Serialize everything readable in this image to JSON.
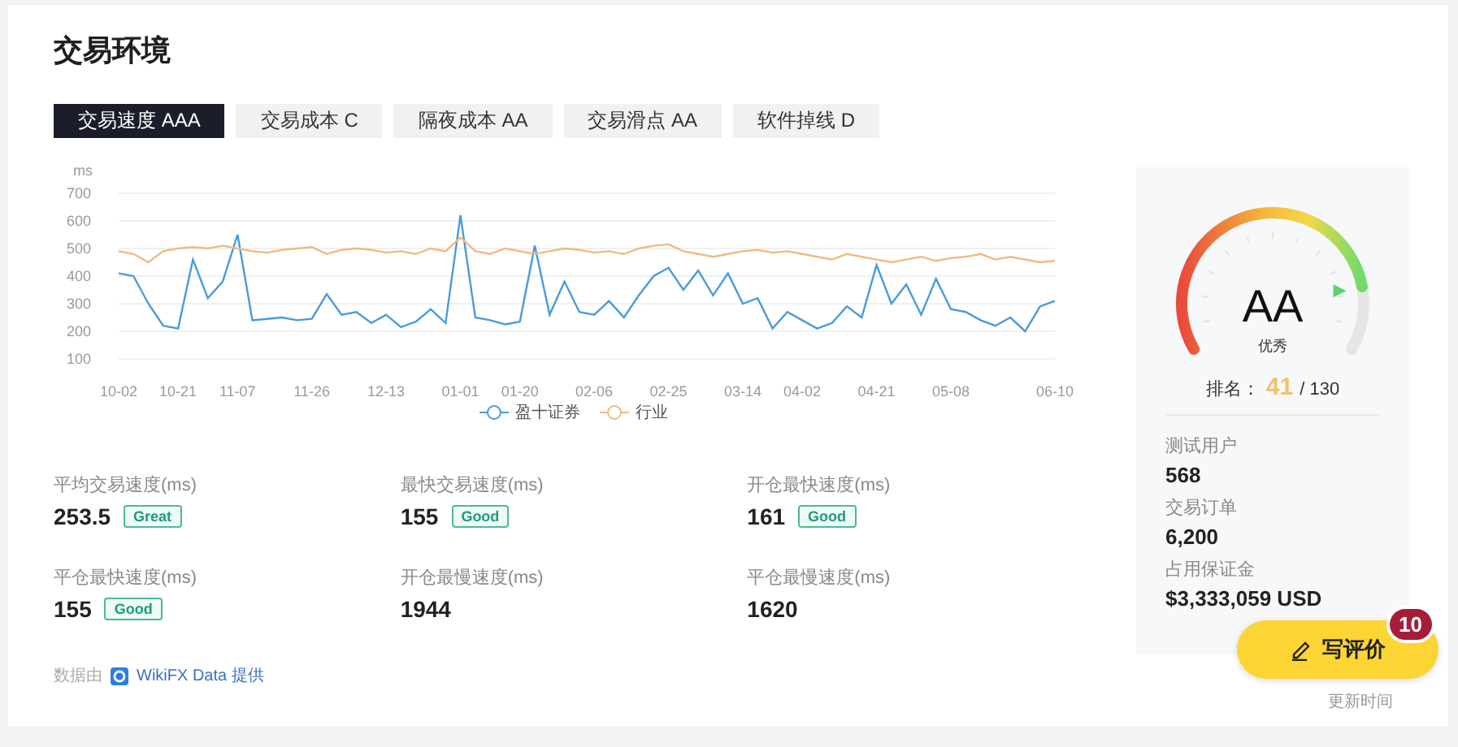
{
  "section": {
    "title": "交易环境"
  },
  "tabs": [
    {
      "label": "交易速度 AAA",
      "selected": true
    },
    {
      "label": "交易成本 C",
      "selected": false
    },
    {
      "label": "隔夜成本 AA",
      "selected": false
    },
    {
      "label": "交易滑点 AA",
      "selected": false
    },
    {
      "label": "软件掉线 D",
      "selected": false
    }
  ],
  "chart": {
    "chart_data": {
      "type": "line",
      "ylabel": "ms",
      "categories": [
        "10-02",
        null,
        null,
        null,
        "10-21",
        null,
        null,
        null,
        "11-07",
        null,
        null,
        null,
        null,
        "11-26",
        null,
        null,
        null,
        null,
        "12-13",
        null,
        null,
        null,
        null,
        "01-01",
        null,
        null,
        null,
        "01-20",
        null,
        null,
        null,
        null,
        "02-06",
        null,
        null,
        null,
        null,
        "02-25",
        null,
        null,
        null,
        null,
        "03-14",
        null,
        null,
        null,
        "04-02",
        null,
        null,
        null,
        null,
        "04-21",
        null,
        null,
        null,
        null,
        "05-08",
        null,
        null,
        null,
        null,
        null,
        null,
        "06-10"
      ],
      "grid": true,
      "ylim": [
        100,
        700
      ],
      "yticks": [
        100,
        200,
        300,
        400,
        500,
        600,
        700
      ],
      "series": [
        {
          "name": "盈十证券",
          "color": "#4a9bdc",
          "values": [
            410,
            400,
            300,
            220,
            210,
            460,
            320,
            380,
            550,
            240,
            245,
            250,
            240,
            245,
            335,
            260,
            270,
            230,
            260,
            215,
            235,
            280,
            230,
            620,
            250,
            240,
            225,
            235,
            510,
            260,
            380,
            270,
            260,
            310,
            250,
            330,
            400,
            430,
            350,
            420,
            330,
            410,
            300,
            320,
            210,
            270,
            240,
            210,
            230,
            290,
            250,
            440,
            300,
            370,
            260,
            390,
            280,
            270,
            240,
            220,
            250,
            200,
            290,
            310
          ]
        },
        {
          "name": "行业",
          "color": "#ecbc80",
          "values": [
            490,
            480,
            450,
            490,
            500,
            505,
            500,
            510,
            500,
            490,
            485,
            495,
            500,
            505,
            480,
            495,
            500,
            495,
            485,
            490,
            480,
            500,
            490,
            540,
            490,
            480,
            500,
            490,
            480,
            490,
            500,
            495,
            485,
            490,
            480,
            500,
            510,
            515,
            490,
            480,
            470,
            480,
            490,
            495,
            485,
            490,
            480,
            470,
            460,
            480,
            470,
            460,
            450,
            460,
            470,
            455,
            465,
            470,
            480,
            460,
            470,
            460,
            450,
            455
          ]
        }
      ]
    }
  },
  "metrics": [
    {
      "label": "平均交易速度(ms)",
      "value": "253.5",
      "badge": "Great"
    },
    {
      "label": "最快交易速度(ms)",
      "value": "155",
      "badge": "Good"
    },
    {
      "label": "开仓最快速度(ms)",
      "value": "161",
      "badge": "Good"
    },
    {
      "label": "平仓最快速度(ms)",
      "value": "155",
      "badge": "Good"
    },
    {
      "label": "开仓最慢速度(ms)",
      "value": "1944"
    },
    {
      "label": "平仓最慢速度(ms)",
      "value": "1620"
    }
  ],
  "rating": {
    "grade": "AA",
    "grade_label": "优秀",
    "level": 0.83,
    "rank_label": "排名：",
    "rank": "41",
    "rank_total": "/ 130",
    "stats": [
      {
        "label": "测试用户",
        "value": "568"
      },
      {
        "label": "交易订单",
        "value": "6,200"
      },
      {
        "label": "占用保证金",
        "value": "$3,333,059 USD"
      }
    ]
  },
  "footer": {
    "prefix": "数据由",
    "source": "WikiFX Data 提供",
    "updated": "更新时间"
  },
  "review_button": {
    "label": "写评价",
    "count": "10"
  }
}
